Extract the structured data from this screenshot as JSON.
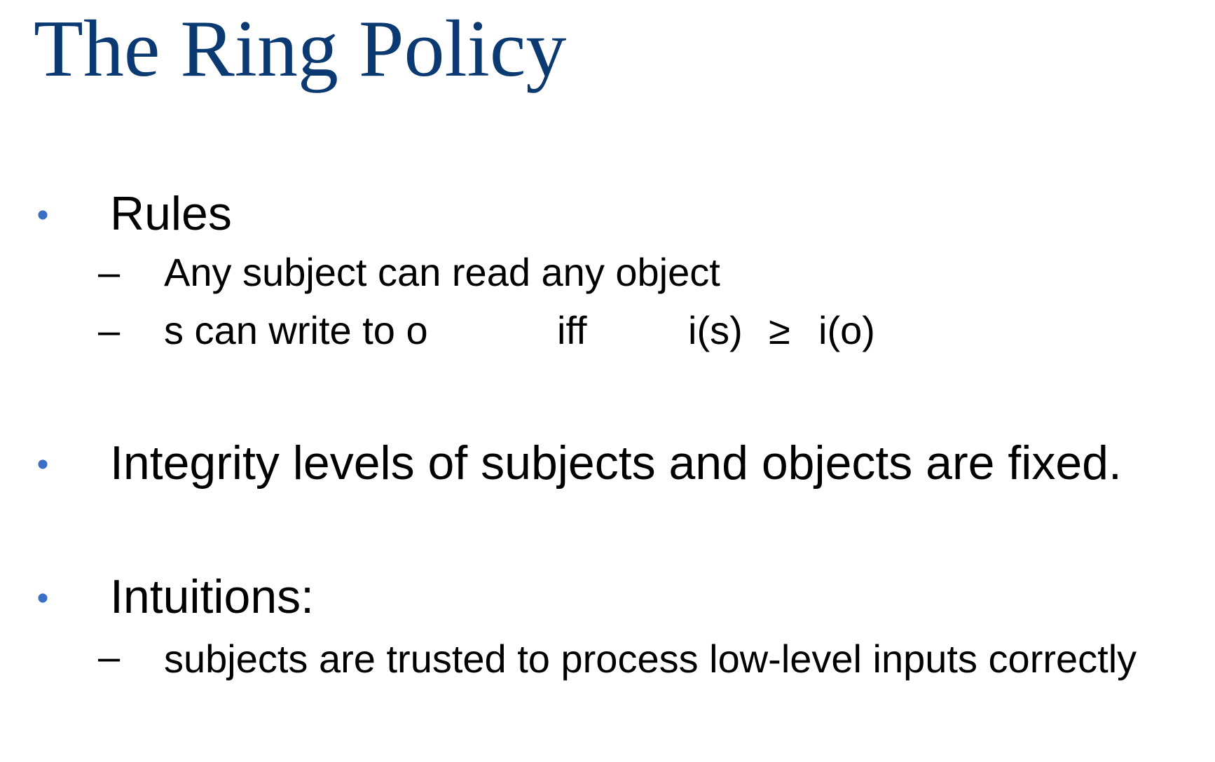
{
  "title": "The Ring Policy",
  "colors": {
    "title": "#0b3a72",
    "bullet": "#3a6fc4",
    "text": "#000000"
  },
  "bullet_symbol": "•",
  "dash_symbol": "–",
  "bullets": [
    {
      "text": "Rules",
      "subitems": [
        {
          "text": "Any subject can read any object"
        },
        {
          "formula": {
            "lhs": "s can write to o",
            "connective": "iff",
            "left_operand": "i(s)",
            "operator": "≥",
            "right_operand": "i(o)"
          }
        }
      ]
    },
    {
      "text": "Integrity levels of subjects and objects are fixed.",
      "subitems": []
    },
    {
      "text": "Intuitions:",
      "subitems": [
        {
          "text": "subjects are trusted to process low-level inputs correctly"
        }
      ]
    }
  ]
}
